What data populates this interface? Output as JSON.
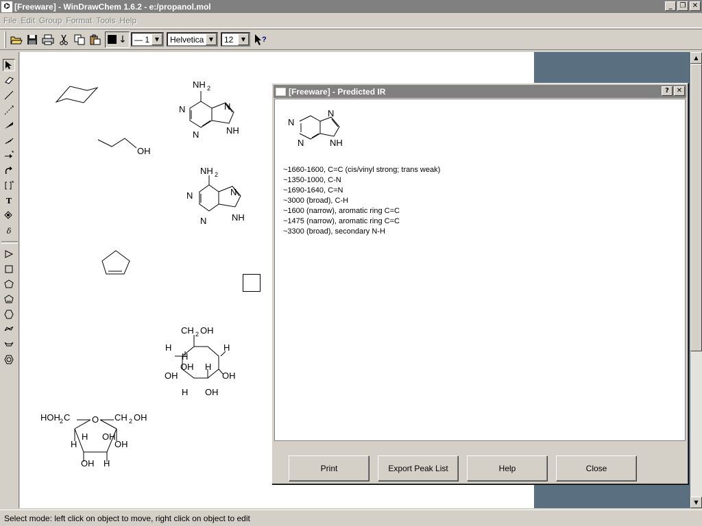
{
  "window": {
    "title": "[Freeware] - WinDrawChem 1.6.2 - e:/propanol.mol",
    "app_icon": "molecule-icon",
    "buttons": [
      "_",
      "❐",
      "✕"
    ]
  },
  "menu": [
    "File",
    "Edit",
    "Group",
    "Format",
    "Tools",
    "Help"
  ],
  "toolbar": {
    "line_width": "— 1",
    "font": "Helvetica",
    "font_size": "12",
    "icons": [
      "open-icon",
      "save-icon",
      "print-icon",
      "cut-icon",
      "copy-icon",
      "paste-icon",
      "color-icon",
      "context-help-icon"
    ]
  },
  "canvas": {
    "labels": {
      "nh2_top": "NH",
      "nh2_top_sub": "2",
      "adenine1_n1": "N",
      "adenine1_n3": "N",
      "adenine1_n7": "N",
      "adenine1_nh": "NH",
      "propanol_oh": "OH",
      "nh2_mid": "NH",
      "nh2_mid_sub": "2",
      "adenine2_n1": "N",
      "adenine2_n3": "N",
      "adenine2_n7": "N",
      "adenine2_nh": "NH",
      "glucose_ch2oh_a": "CH",
      "glucose_ch2oh_sub": "2",
      "glucose_ch2oh_b": "OH",
      "glucose_h1": "H",
      "glucose_h2": "H",
      "glucose_h3": "H",
      "glucose_oh1": "OH",
      "glucose_h4": "H",
      "glucose_oh2": "OH",
      "glucose_oh3": "OH",
      "glucose_h5": "H",
      "glucose_oh4": "OH",
      "furanose_hoh2c_a": "HOH",
      "furanose_hoh2c_sub": "2",
      "furanose_hoh2c_b": "C",
      "furanose_o": "O",
      "furanose_ch2oh_a": "CH",
      "furanose_ch2oh_sub": "2",
      "furanose_ch2oh_b": "OH",
      "furanose_h1": "H",
      "furanose_oh1": "OH",
      "furanose_h2": "H",
      "furanose_oh2": "OH",
      "furanose_oh3": "OH",
      "furanose_h3": "H"
    }
  },
  "dialog": {
    "title": "[Freeware] - Predicted IR",
    "buttons": [
      "?",
      "✕"
    ],
    "molecule_labels": {
      "n1": "N",
      "n3": "N",
      "n7": "N",
      "nh": "NH"
    },
    "peaks": [
      "~1660-1600, C=C (cis/vinyl strong; trans weak)",
      "~1350-1000, C-N",
      "~1690-1640, C=N",
      "~3000 (broad), C-H",
      "~1600 (narrow), aromatic ring C=C",
      "~1475 (narrow), aromatic ring C=C",
      "~3300 (broad), secondary N-H"
    ],
    "actions": {
      "print": "Print",
      "export": "Export Peak List",
      "help": "Help",
      "close": "Close"
    }
  },
  "status": "Select mode: left click on object to move, right click on object to edit"
}
